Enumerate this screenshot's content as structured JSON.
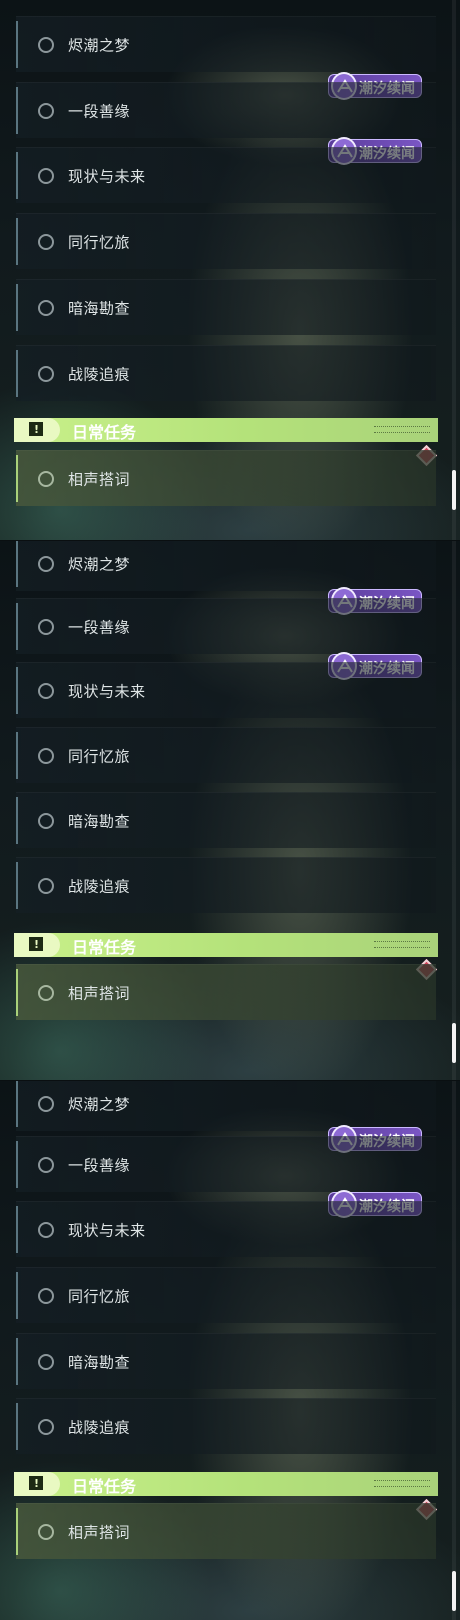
{
  "badge_text": "潮汐续闻",
  "section_title": "日常任务",
  "section_icon": "exclamation-icon",
  "quests": [
    "烬潮之梦",
    "一段善缘",
    "现状与未来",
    "同行忆旅",
    "暗海勘查",
    "战陵追痕"
  ],
  "daily_quest": "相声搭词",
  "colors": {
    "accent_green": "#c8f08a",
    "badge_purple": "#6a47b0",
    "marker_red": "#d2455a"
  },
  "panels": [
    {
      "view": 1
    },
    {
      "view": 2
    },
    {
      "view": 3
    }
  ]
}
